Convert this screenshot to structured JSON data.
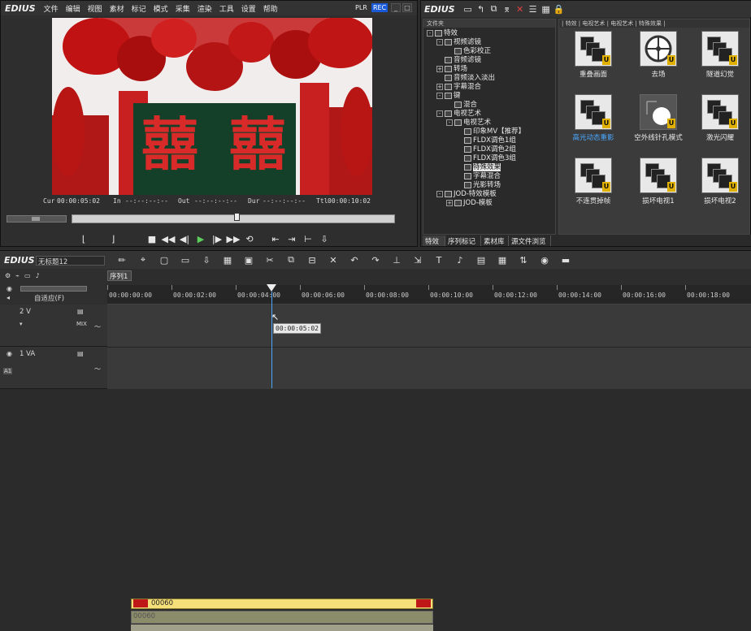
{
  "app": {
    "logo": "EDIUS",
    "menu": [
      "文件",
      "编辑",
      "视图",
      "素材",
      "标记",
      "模式",
      "采集",
      "渲染",
      "工具",
      "设置",
      "帮助"
    ],
    "plr": "PLR",
    "rec": "REC",
    "winbtns": [
      "_",
      "□"
    ]
  },
  "player": {
    "cur_label": "Cur",
    "cur_value": "00:00:05:02",
    "in_label": "In",
    "in_value": "--:--:--:--",
    "out_label": "Out",
    "out_value": "--:--:--:--",
    "dur_label": "Dur",
    "dur_value": "--:--:--:--",
    "ttl_label": "Ttl",
    "ttl_value": "00:00:10:02",
    "scrub_position": 0.51
  },
  "effects_panel": {
    "logo": "EDIUS",
    "folder_header": "文件夹",
    "breadcrumb": "| 特效 | 电视艺术 | 电视艺术 | 特殊效果 |",
    "tree": [
      {
        "label": "特效",
        "level": 0,
        "exp": "-"
      },
      {
        "label": "视频滤镜",
        "level": 1,
        "exp": "-"
      },
      {
        "label": "色彩校正",
        "level": 2,
        "exp": ""
      },
      {
        "label": "音频滤镜",
        "level": 1,
        "exp": ""
      },
      {
        "label": "转场",
        "level": 1,
        "exp": "+"
      },
      {
        "label": "音频淡入淡出",
        "level": 1,
        "exp": ""
      },
      {
        "label": "字幕混合",
        "level": 1,
        "exp": "+"
      },
      {
        "label": "键",
        "level": 1,
        "exp": "-"
      },
      {
        "label": "混合",
        "level": 2,
        "exp": ""
      },
      {
        "label": "电视艺术",
        "level": 1,
        "exp": "-"
      },
      {
        "label": "电视艺术",
        "level": 2,
        "exp": "-"
      },
      {
        "label": "印象MV【推荐】",
        "level": 3,
        "exp": ""
      },
      {
        "label": "FLDX调色1组",
        "level": 3,
        "exp": ""
      },
      {
        "label": "FLDX调色2组",
        "level": 3,
        "exp": ""
      },
      {
        "label": "FLDX调色3组",
        "level": 3,
        "exp": ""
      },
      {
        "label": "特殊效果",
        "level": 3,
        "exp": "",
        "selected": true
      },
      {
        "label": "字幕混合",
        "level": 3,
        "exp": ""
      },
      {
        "label": "光影转场",
        "level": 3,
        "exp": ""
      },
      {
        "label": "JOD-特效模板",
        "level": 1,
        "exp": "-"
      },
      {
        "label": "JOD-模板",
        "level": 2,
        "exp": "+"
      }
    ],
    "effects": [
      {
        "label": "重叠画面",
        "highlight": false
      },
      {
        "label": "去场",
        "highlight": false
      },
      {
        "label": "隧道幻觉",
        "highlight": false
      },
      {
        "label": "高光动态重影",
        "highlight": true
      },
      {
        "label": "空外线针孔模式",
        "highlight": false
      },
      {
        "label": "激光闪耀",
        "highlight": false
      },
      {
        "label": "不连贯掉帧",
        "highlight": false
      },
      {
        "label": "损坏电视1",
        "highlight": false
      },
      {
        "label": "损坏电视2",
        "highlight": false
      }
    ],
    "tabs": [
      "特效",
      "序列标记",
      "素材库",
      "源文件浏览"
    ]
  },
  "timeline": {
    "logo": "EDIUS",
    "project_name": "无标题12",
    "sequence_tab": "序列1",
    "mode_label": "自适应(F)",
    "ruler": [
      "00:00:00:00",
      "00:00:02:00",
      "00:00:04:00",
      "00:00:06:00",
      "00:00:08:00",
      "00:00:10:00",
      "00:00:12:00",
      "00:00:14:00",
      "00:00:16:00",
      "00:00:18:00"
    ],
    "playhead_tooltip": "00:00:05:02",
    "tracks": [
      {
        "name": "2 V",
        "mix": "MIX"
      },
      {
        "name": "1 VA",
        "clip": "00060",
        "audio_clip": "00060"
      }
    ],
    "a_label": "A1"
  },
  "colors": {
    "rec_bg": "#1a5ad8",
    "clip_yellow": "#f6e07a",
    "clip_audio": "#8a8c6a",
    "accent_blue": "#4aa8ff"
  }
}
